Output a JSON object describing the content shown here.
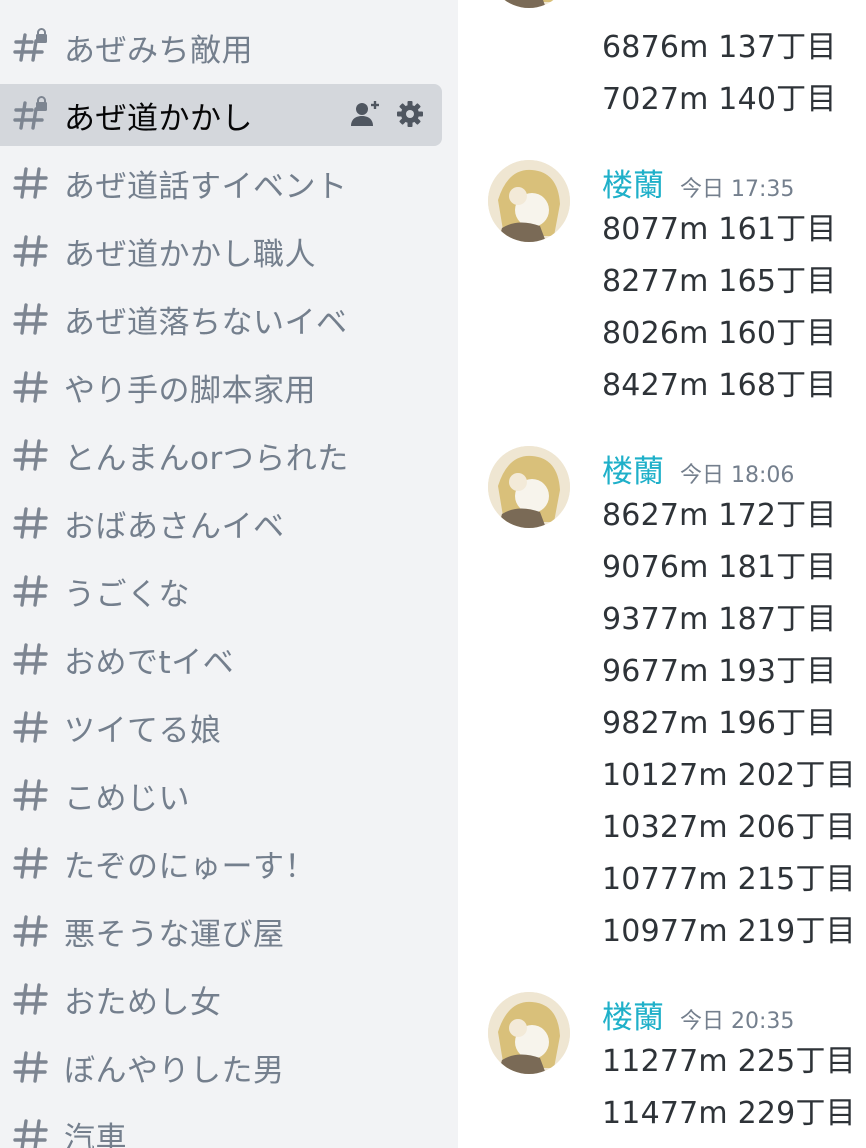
{
  "sidebar": {
    "channels": [
      {
        "name": "あぜみち敵用",
        "locked": true
      },
      {
        "name": "あぜ道かかし",
        "locked": true,
        "active": true
      },
      {
        "name": "あぜ道話すイベント"
      },
      {
        "name": "あぜ道かかし職人"
      },
      {
        "name": "あぜ道落ちないイベ"
      },
      {
        "name": "やり手の脚本家用"
      },
      {
        "name": "とんまんorつられた"
      },
      {
        "name": "おばあさんイベ"
      },
      {
        "name": "うごくな"
      },
      {
        "name": "おめでtイベ"
      },
      {
        "name": "ツイてる娘"
      },
      {
        "name": "こめじい"
      },
      {
        "name": "たぞのにゅーす！"
      },
      {
        "name": "悪そうな運び屋"
      },
      {
        "name": "おためし女"
      },
      {
        "name": "ぼんやりした男"
      },
      {
        "name": "汽車"
      }
    ],
    "active_actions": [
      "add-member-icon",
      "gear-icon"
    ]
  },
  "chat": {
    "continued_lines": [
      "6876m 137丁目",
      "7027m 140丁目"
    ],
    "messages": [
      {
        "author": "楼蘭",
        "timestamp": "今日 17:35",
        "lines": [
          "8077m 161丁目",
          "8277m 165丁目",
          "8026m 160丁目",
          "8427m 168丁目"
        ]
      },
      {
        "author": "楼蘭",
        "timestamp": "今日 18:06",
        "lines": [
          "8627m 172丁目",
          "9076m 181丁目",
          "9377m 187丁目",
          "9677m 193丁目",
          "9827m 196丁目",
          "10127m 202丁目",
          "10327m 206丁目",
          "10777m 215丁目",
          "10977m 219丁目"
        ]
      },
      {
        "author": "楼蘭",
        "timestamp": "今日 20:35",
        "lines": [
          "11277m 225丁目",
          "11477m 229丁目"
        ]
      }
    ]
  },
  "colors": {
    "sidebar_bg": "#f2f3f5",
    "active_bg": "#d4d7dc",
    "channel_text": "#747f8d",
    "author": "#1fb0c9",
    "message_text": "#2e3338"
  }
}
